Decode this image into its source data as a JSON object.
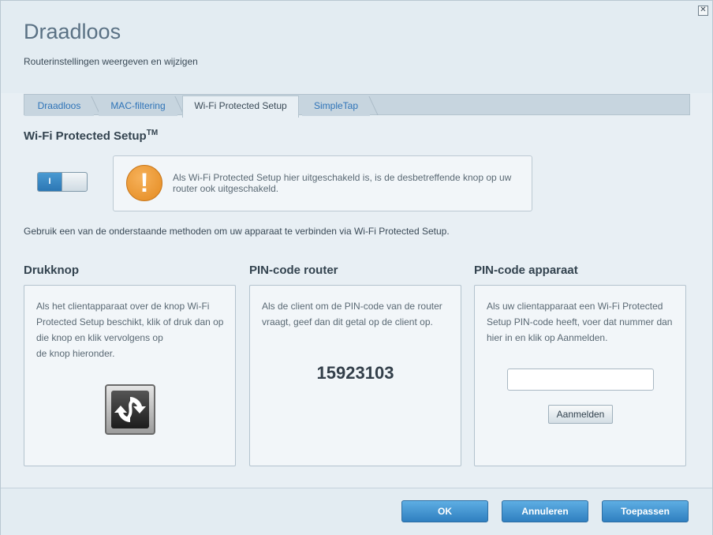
{
  "header": {
    "title": "Draadloos",
    "subtitle": "Routerinstellingen weergeven en wijzigen",
    "close_glyph": "✕"
  },
  "tabs": [
    {
      "label": "Draadloos",
      "active": false
    },
    {
      "label": "MAC-filtering",
      "active": false
    },
    {
      "label": "Wi-Fi Protected Setup",
      "active": true
    },
    {
      "label": "SimpleTap",
      "active": false
    }
  ],
  "section": {
    "title": "Wi-Fi Protected Setup",
    "trademark": "TM",
    "toggle_label": "I",
    "toggle_on": true,
    "warning_text": "Als Wi-Fi Protected Setup hier uitgeschakeld is, is de desbetreffende knop op uw router ook uitgeschakeld.",
    "warning_glyph": "!",
    "instruction": "Gebruik een van de onderstaande methoden om uw apparaat te verbinden via Wi-Fi Protected Setup."
  },
  "methods": {
    "pushbutton": {
      "title": "Drukknop",
      "lines": [
        "Als het clientapparaat over de knop Wi-Fi",
        "Protected Setup beschikt, klik of druk dan op",
        "die knop en klik vervolgens op",
        "de knop hieronder."
      ]
    },
    "router_pin": {
      "title": "PIN-code router",
      "lines": [
        "Als de client om de PIN-code van de router",
        "vraagt, geef dan dit getal op de client op."
      ],
      "pin": "15923103"
    },
    "device_pin": {
      "title": "PIN-code apparaat",
      "lines": [
        "Als uw clientapparaat een Wi-Fi Protected",
        "Setup PIN-code heeft, voer dat nummer dan",
        "hier in en klik op Aanmelden."
      ],
      "input_value": "",
      "register_label": "Aanmelden"
    }
  },
  "footer": {
    "ok_label": "OK",
    "cancel_label": "Annuleren",
    "apply_label": "Toepassen"
  },
  "colors": {
    "accent": "#2f7fc0",
    "warning": "#e48a1f",
    "link": "#2f74b8"
  }
}
